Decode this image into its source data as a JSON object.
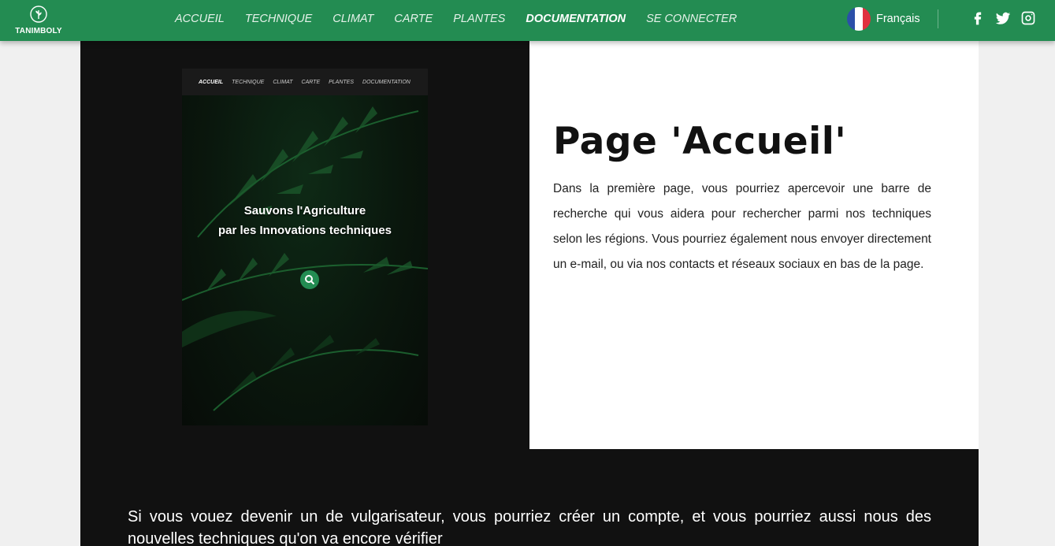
{
  "brand": {
    "name": "TANIMBOLY",
    "icon": "leaf-circle-icon"
  },
  "nav": {
    "items": [
      {
        "label": "ACCUEIL",
        "active": false
      },
      {
        "label": "TECHNIQUE",
        "active": false
      },
      {
        "label": "CLIMAT",
        "active": false
      },
      {
        "label": "CARTE",
        "active": false
      },
      {
        "label": "PLANTES",
        "active": false
      },
      {
        "label": "DOCUMENTATION",
        "active": true
      },
      {
        "label": "SE CONNECTER",
        "active": false
      }
    ],
    "language": {
      "label": "Français",
      "icon": "france-flag-icon"
    },
    "socials": [
      {
        "name": "facebook-icon"
      },
      {
        "name": "twitter-icon"
      },
      {
        "name": "instagram-icon"
      }
    ]
  },
  "preview": {
    "nav_items": [
      "ACCUEIL",
      "TECHNIQUE",
      "CLIMAT",
      "CARTE",
      "PLANTES",
      "DOCUMENTATION"
    ],
    "title_line1": "Sauvons l'Agriculture",
    "title_line2": "par les Innovations techniques",
    "search_icon": "search-icon"
  },
  "section": {
    "title": "Page 'Accueil'",
    "text": "Dans la première page, vous pourriez apercevoir une barre de recherche qui vous aidera pour rechercher parmi nos techniques selon les régions. Vous pourriez également nous envoyer directement un e-mail, ou via nos contacts et réseaux sociaux en bas de la page."
  },
  "bottom_text": "Si vous vouez devenir un de vulgarisateur, vous pourriez créer un compte, et vous pourriez aussi nous des nouvelles techniques qu'on va encore vérifier",
  "colors": {
    "brand_green": "#238c52",
    "panel_dark": "#111111",
    "page_bg": "#f0f0f0"
  }
}
